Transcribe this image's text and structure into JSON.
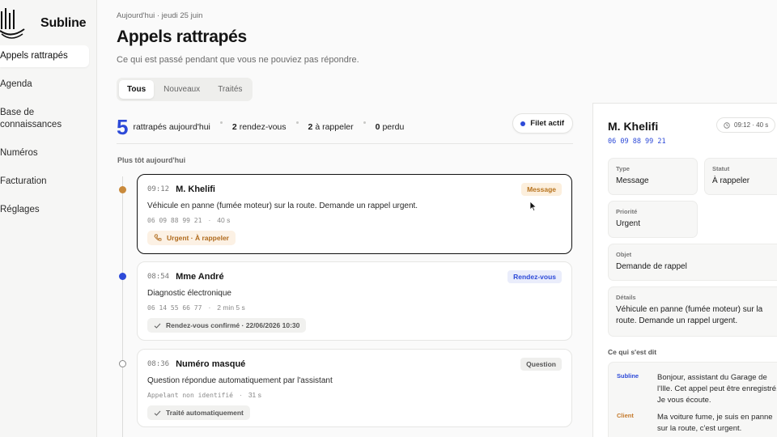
{
  "brand": {
    "name": "Subline",
    "logo_icon": "sail-logo-icon"
  },
  "sidebar": {
    "items": [
      {
        "label": "Appels rattrapés",
        "active": true
      },
      {
        "label": "Agenda"
      },
      {
        "label": "Base de connaissances"
      },
      {
        "label": "Numéros"
      },
      {
        "label": "Facturation"
      },
      {
        "label": "Réglages"
      }
    ]
  },
  "header": {
    "date": "Aujourd'hui · jeudi 25 juin",
    "title": "Appels rattrapés",
    "subtitle": "Ce qui est passé pendant que vous ne pouviez pas répondre."
  },
  "tabs": [
    {
      "label": "Tous",
      "active": true
    },
    {
      "label": "Nouveaux"
    },
    {
      "label": "Traités"
    }
  ],
  "stats": {
    "count": "5",
    "count_label": "rattrapés aujourd'hui",
    "rdv_num": "2",
    "rdv_label": "rendez-vous",
    "callback_num": "2",
    "callback_label": "à rappeler",
    "lost_num": "0",
    "lost_label": "perdu",
    "filet_label": "Filet actif"
  },
  "section_label": "Plus tôt aujourd'hui",
  "calls": [
    {
      "time": "09:12",
      "name": "M. Khelifi",
      "badge": "Message",
      "description": "Véhicule en panne (fumée moteur) sur la route. Demande un rappel urgent.",
      "phone": "06 09 88 99 21",
      "duration": "40 s",
      "chip": "Urgent · À rappeler"
    },
    {
      "time": "08:54",
      "name": "Mme André",
      "badge": "Rendez-vous",
      "description": "Diagnostic électronique",
      "phone": "06 14 55 66 77",
      "duration": "2 min 5 s",
      "chip": "Rendez-vous confirmé · 22/06/2026 10:30"
    },
    {
      "time": "08:36",
      "name": "Numéro masqué",
      "badge": "Question",
      "description": "Question répondue automatiquement par l'assistant",
      "phone": "Appelant non identifié",
      "duration": "31 s",
      "chip": "Traité automatiquement"
    }
  ],
  "detail": {
    "name": "M. Khelifi",
    "phone": "06 09 88 99 21",
    "timer": "09:12 · 40 s",
    "type_label": "Type",
    "type_value": "Message",
    "status_label": "Statut",
    "status_value": "À rappeler",
    "priority_label": "Priorité",
    "priority_value": "Urgent",
    "subject_label": "Objet",
    "subject_value": "Demande de rappel",
    "details_label": "Détails",
    "details_value": "Véhicule en panne (fumée moteur) sur la route. Demande un rappel urgent.",
    "conv_label": "Ce qui s'est dit",
    "messages": [
      {
        "who": "Subline",
        "lines": [
          "Bonjour, assistant du Garage de",
          "l'Ille. Cet appel peut être enregistré.",
          "Je vous écoute."
        ]
      },
      {
        "who": "Client",
        "lines": [
          "Ma voiture fume, je suis en panne",
          "sur la route, c'est urgent."
        ]
      }
    ]
  },
  "colors": {
    "accent": "#2d4ad8",
    "orange": "#c47a2c",
    "message_badge_bg": "#fcefdd",
    "rdv_badge_bg": "#eaedfb"
  }
}
